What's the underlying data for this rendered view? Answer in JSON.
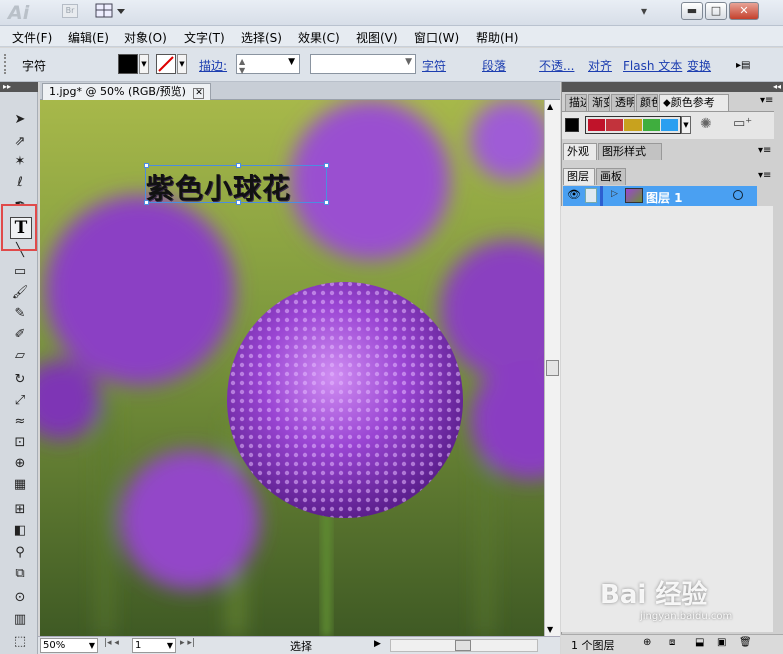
{
  "app": {
    "logo": "Ai",
    "bridge_label": "Br"
  },
  "window_buttons": {
    "minimize": "▬",
    "restore": "□",
    "close": "✕"
  },
  "menu": [
    "文件(F)",
    "编辑(E)",
    "对象(O)",
    "文字(T)",
    "选择(S)",
    "效果(C)",
    "视图(V)",
    "窗口(W)",
    "帮助(H)"
  ],
  "control": {
    "label": "字符",
    "stroke_label": "描边:",
    "char_link": "字符",
    "para_link": "段落",
    "opacity_link": "不透...",
    "align_link": "对齐",
    "flash_link": "Flash 文本",
    "transform_link": "变换"
  },
  "document": {
    "tab_title": "1.jpg* @ 50% (RGB/预览)",
    "text_content": "紫色小球花"
  },
  "status": {
    "zoom": "50%",
    "page": "1",
    "mode": "选择"
  },
  "panels": {
    "top_tabs": [
      "描边",
      "渐变",
      "透明",
      "颜色",
      "颜色参考"
    ],
    "mid_tabs": [
      "外观",
      "图形样式"
    ],
    "layer_tabs": [
      "图层",
      "画板"
    ],
    "layer_name": "图层 1",
    "layer_count": "1 个图层"
  },
  "colors": {
    "accent": "#4aa0f2",
    "highlight": "#e04a4a",
    "guide": [
      "#c0132a",
      "#c2333c",
      "#c8a21e",
      "#3fae3e",
      "#2a9ff0"
    ]
  },
  "watermark": {
    "brand": "Bai 经验",
    "url": "jingyan.baidu.com"
  }
}
